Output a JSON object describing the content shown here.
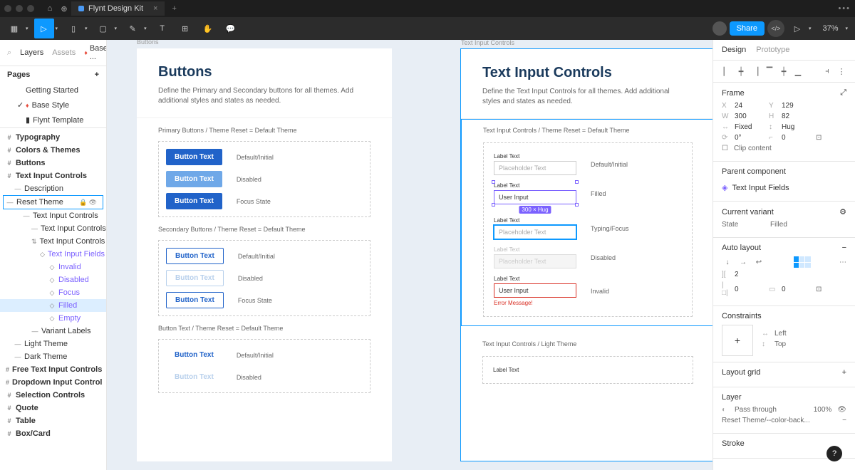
{
  "titlebar": {
    "filename": "Flynt Design Kit"
  },
  "toolbar": {
    "share": "Share",
    "zoom": "37%"
  },
  "left": {
    "tabs": {
      "layers": "Layers",
      "assets": "Assets",
      "base": "Base ..."
    },
    "pages_label": "Pages",
    "pages": [
      "Getting Started",
      "Base Style",
      "Flynt Template"
    ],
    "layers": [
      {
        "ind": 0,
        "ico": "#",
        "txt": "Typography",
        "bold": true
      },
      {
        "ind": 0,
        "ico": "#",
        "txt": "Colors & Themes",
        "bold": true
      },
      {
        "ind": 0,
        "ico": "#",
        "txt": "Buttons",
        "bold": true
      },
      {
        "ind": 0,
        "ico": "#",
        "txt": "Text Input Controls",
        "bold": true
      },
      {
        "ind": 1,
        "ico": "—",
        "txt": "Description"
      },
      {
        "ind": 1,
        "ico": "—",
        "txt": "Reset Theme",
        "boxed": true,
        "end": true
      },
      {
        "ind": 2,
        "ico": "—",
        "txt": "Text Input Controls"
      },
      {
        "ind": 3,
        "ico": "—",
        "txt": "Text Input Controls"
      },
      {
        "ind": 3,
        "ico": "⇅",
        "txt": "Text Input Controls"
      },
      {
        "ind": 4,
        "ico": "◇",
        "txt": "Text Input Fields",
        "purple": true
      },
      {
        "ind": 5,
        "ico": "◇",
        "txt": "Invalid",
        "purple": true
      },
      {
        "ind": 5,
        "ico": "◇",
        "txt": "Disabled",
        "purple": true
      },
      {
        "ind": 5,
        "ico": "◇",
        "txt": "Focus",
        "purple": true
      },
      {
        "ind": 5,
        "ico": "◇",
        "txt": "Filled",
        "purple": true,
        "hl": true
      },
      {
        "ind": 5,
        "ico": "◇",
        "txt": "Empty",
        "purple": true
      },
      {
        "ind": 3,
        "ico": "—",
        "txt": "Variant Labels"
      },
      {
        "ind": 1,
        "ico": "—",
        "txt": "Light Theme"
      },
      {
        "ind": 1,
        "ico": "—",
        "txt": "Dark Theme"
      },
      {
        "ind": 0,
        "ico": "#",
        "txt": "Free Text Input Controls",
        "bold": true
      },
      {
        "ind": 0,
        "ico": "#",
        "txt": "Dropdown Input Control",
        "bold": true
      },
      {
        "ind": 0,
        "ico": "#",
        "txt": "Selection Controls",
        "bold": true
      },
      {
        "ind": 0,
        "ico": "#",
        "txt": "Quote",
        "bold": true
      },
      {
        "ind": 0,
        "ico": "#",
        "txt": "Table",
        "bold": true
      },
      {
        "ind": 0,
        "ico": "#",
        "txt": "Box/Card",
        "bold": true
      }
    ]
  },
  "canvas": {
    "buttons": {
      "label": "Buttons",
      "title": "Buttons",
      "desc": "Define the Primary and Secondary buttons for all themes. Add additional styles and states as needed.",
      "sec1": "Primary Buttons / Theme Reset = Default Theme",
      "sec2": "Secondary Buttons / Theme Reset = Default Theme",
      "sec3": "Button Text / Theme Reset = Default Theme",
      "btn": "Button Text",
      "states": {
        "default": "Default/Initial",
        "disabled": "Disabled",
        "focus": "Focus State"
      }
    },
    "tic": {
      "label": "Text Input Controls",
      "title": "Text Input Controls",
      "desc": "Define the Text Input Controls for all themes. Add additional styles and states as needed.",
      "sec1": "Text Input Controls / Theme Reset = Default Theme",
      "sec2": "Text Input Controls / Light Theme",
      "lbl": "Label Text",
      "placeholder": "Placeholder Text",
      "user": "User Input",
      "err": "Error Message!",
      "dim": "300 × Hug",
      "states": {
        "default": "Default/Initial",
        "filled": "Filled",
        "focus": "Typing/Focus",
        "disabled": "Disabled",
        "invalid": "Invalid"
      }
    }
  },
  "right": {
    "tabs": {
      "design": "Design",
      "proto": "Prototype"
    },
    "frame": {
      "label": "Frame",
      "x": "24",
      "y": "129",
      "w": "300",
      "h": "82",
      "fixed": "Fixed",
      "hug": "Hug",
      "rot": "0°",
      "rad": "0",
      "clip": "Clip content"
    },
    "parent": {
      "label": "Parent component",
      "name": "Text Input Fields"
    },
    "variant": {
      "label": "Current variant",
      "state_k": "State",
      "state_v": "Filled"
    },
    "auto": {
      "label": "Auto layout",
      "gap": "2",
      "padh": "0",
      "padv": "0"
    },
    "constraints": {
      "label": "Constraints",
      "h": "Left",
      "v": "Top"
    },
    "layout_grid": "Layout grid",
    "layer": {
      "label": "Layer",
      "mode": "Pass through",
      "opacity": "100%",
      "fill": "Reset Theme/--color-back..."
    },
    "stroke": "Stroke"
  }
}
